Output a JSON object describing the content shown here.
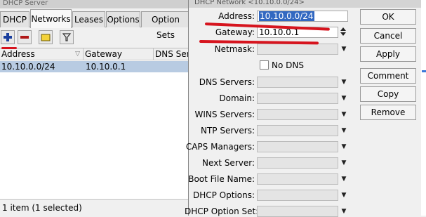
{
  "background_window": {
    "title": "DHCP Server",
    "tabs": [
      "DHCP",
      "Networks",
      "Leases",
      "Options",
      "Option Sets"
    ],
    "active_tab": "Networks",
    "columns": [
      "Address",
      "Gateway",
      "DNS Servers"
    ],
    "rows": [
      {
        "address": "10.10.0.0/24",
        "gateway": "10.10.0.1"
      }
    ],
    "status": "1 item (1 selected)"
  },
  "dialog": {
    "title": "DHCP Network <10.10.0.0/24>",
    "fields": {
      "address": {
        "label": "Address:",
        "value": "10.10.0.0/24"
      },
      "gateway": {
        "label": "Gateway:",
        "value": "10.10.0.1"
      },
      "netmask": {
        "label": "Netmask:",
        "value": ""
      },
      "no_dns": {
        "label": "No DNS"
      },
      "dns_servers": {
        "label": "DNS Servers:"
      },
      "domain": {
        "label": "Domain:"
      },
      "wins_servers": {
        "label": "WINS Servers:"
      },
      "ntp_servers": {
        "label": "NTP Servers:"
      },
      "caps_managers": {
        "label": "CAPS Managers:"
      },
      "next_server": {
        "label": "Next Server:"
      },
      "boot_file_name": {
        "label": "Boot File Name:"
      },
      "dhcp_options": {
        "label": "DHCP Options:"
      },
      "dhcp_option_set": {
        "label": "DHCP Option Set:"
      }
    },
    "buttons": {
      "ok": "OK",
      "cancel": "Cancel",
      "apply": "Apply",
      "comment": "Comment",
      "copy": "Copy",
      "remove": "Remove"
    }
  },
  "colors": {
    "selection": "#3268c1",
    "row_selected": "#b8cbe2",
    "annotation": "#d6141e",
    "add_icon": "#1a3f9e",
    "remove_icon": "#b01818"
  }
}
